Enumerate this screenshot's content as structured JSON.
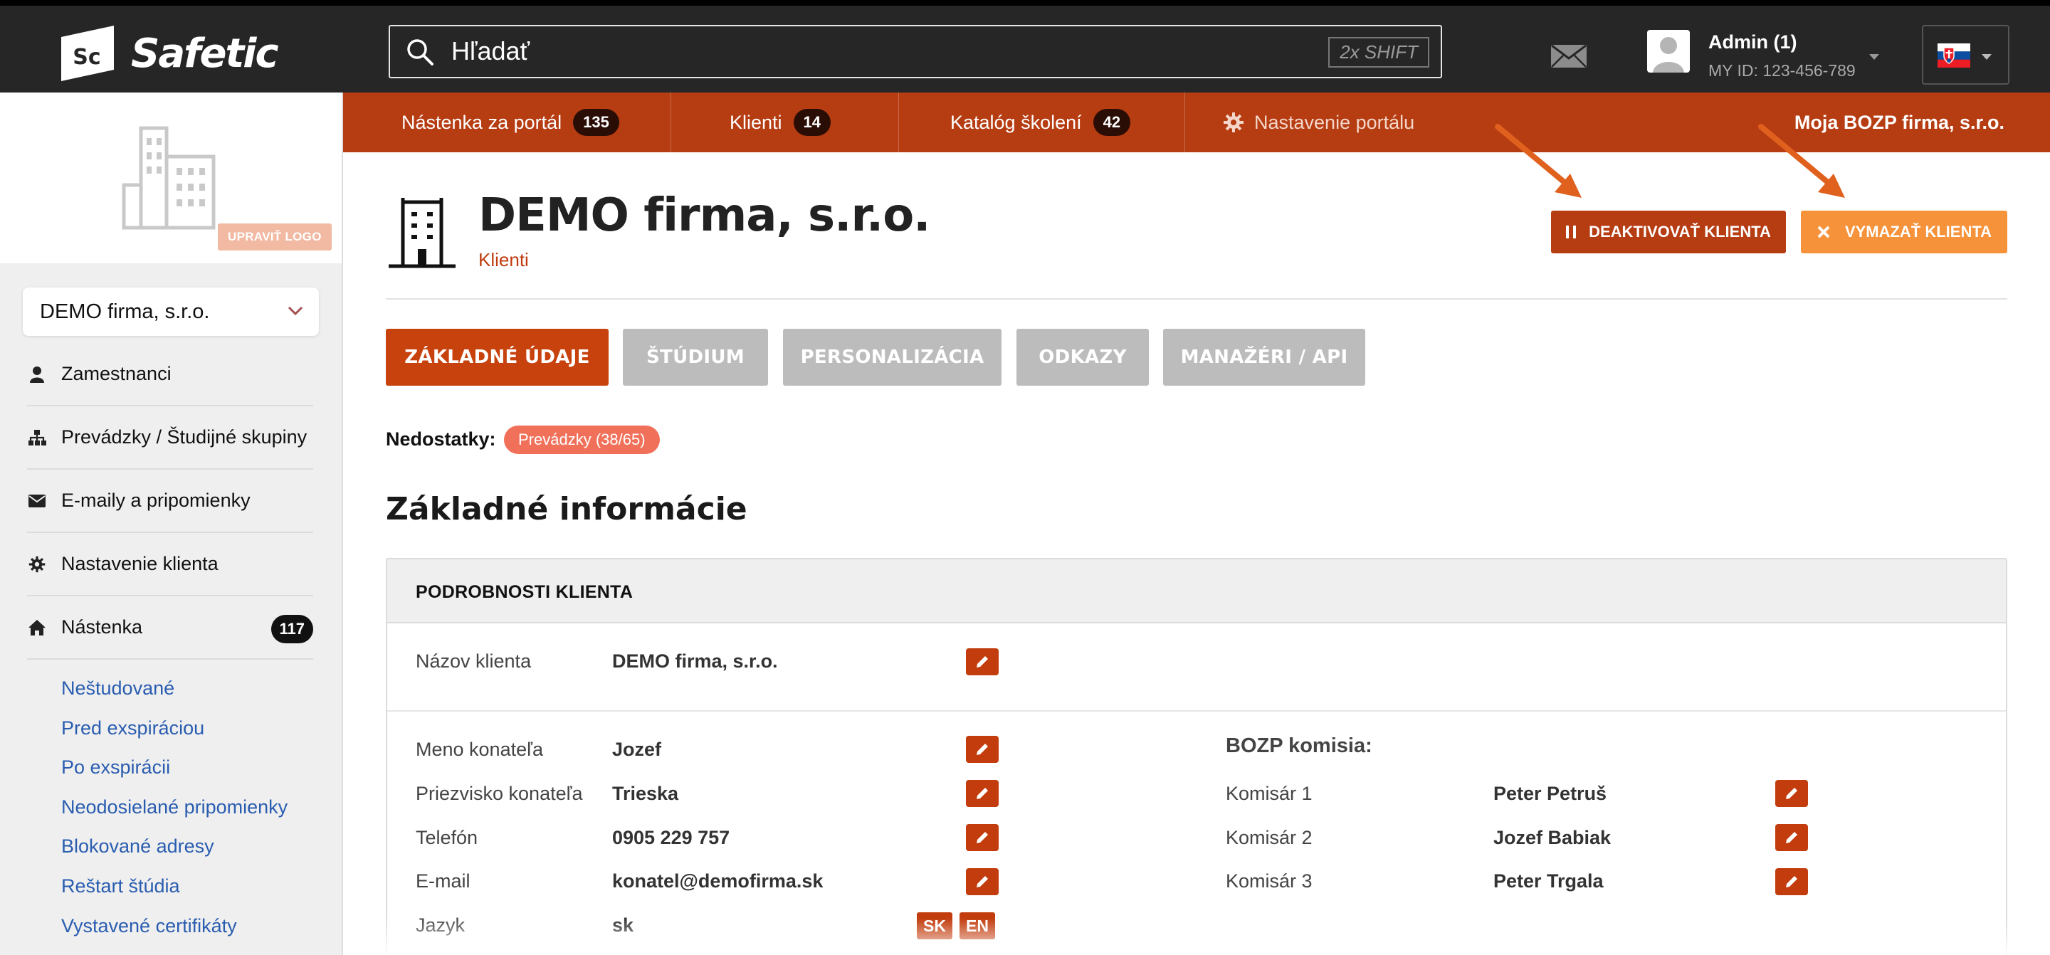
{
  "app": {
    "name": "Safetic",
    "logo_mark": "Sc"
  },
  "search": {
    "placeholder": "Hľadať",
    "shortcut_hint": "2x SHIFT"
  },
  "user": {
    "name": "Admin (1)",
    "id_label": "MY ID: 123-456-789"
  },
  "language_flag": "slovak-flag-icon",
  "nav": {
    "items": [
      {
        "label": "Nástenka za portál",
        "count": "135"
      },
      {
        "label": "Klienti",
        "count": "14"
      },
      {
        "label": "Katalóg školení",
        "count": "42"
      },
      {
        "label": "Nastavenie portálu"
      }
    ],
    "company": "Moja BOZP firma, s.r.o."
  },
  "sidebar": {
    "edit_logo": "UPRAVIŤ LOGO",
    "client_selected": "DEMO firma, s.r.o.",
    "items": [
      {
        "label": "Zamestnanci",
        "icon": "person-icon"
      },
      {
        "label": "Prevádzky / Študijné skupiny",
        "icon": "org-chart-icon"
      },
      {
        "label": "E-maily a pripomienky",
        "icon": "envelope-icon"
      },
      {
        "label": "Nastavenie klienta",
        "icon": "gear-icon"
      },
      {
        "label": "Nástenka",
        "icon": "home-icon",
        "count": "117"
      }
    ],
    "sub_links": [
      "Neštudované",
      "Pred exspiráciou",
      "Po exspirácii",
      "Neodosielané pripomienky",
      "Blokované adresy",
      "Reštart štúdia",
      "Vystavené certifikáty"
    ]
  },
  "page": {
    "title": "DEMO firma, s.r.o.",
    "breadcrumb": "Klienti",
    "deactivate_label": "DEAKTIVOVAŤ KLIENTA",
    "delete_label": "VYMAZAŤ KLIENTA"
  },
  "tabs": [
    {
      "label": "ZÁKLADNÉ ÚDAJE",
      "active": true
    },
    {
      "label": "ŠTÚDIUM",
      "active": false
    },
    {
      "label": "PERSONALIZÁCIA",
      "active": false
    },
    {
      "label": "ODKAZY",
      "active": false
    },
    {
      "label": "MANAŽÉRI / API",
      "active": false
    }
  ],
  "issues": {
    "label": "Nedostatky:",
    "pill": "Prevádzky (38/65)"
  },
  "section_title": "Základné informácie",
  "details": {
    "header": "PODROBNOSTI KLIENTA",
    "client_name_label": "Názov klienta",
    "client_name_value": "DEMO firma, s.r.o.",
    "fields": [
      {
        "label": "Meno konateľa",
        "value": "Jozef"
      },
      {
        "label": "Priezvisko konateľa",
        "value": "Trieska"
      },
      {
        "label": "Telefón",
        "value": "0905 229 757"
      },
      {
        "label": "E-mail",
        "value": "konatel@demofirma.sk"
      },
      {
        "label": "Jazyk",
        "value": "sk"
      }
    ],
    "languages": [
      "SK",
      "EN"
    ],
    "committee": {
      "title": "BOZP komisia:",
      "members": [
        {
          "label": "Komisár 1",
          "value": "Peter Petruš"
        },
        {
          "label": "Komisár 2",
          "value": "Jozef Babiak"
        },
        {
          "label": "Komisár 3",
          "value": "Peter Trgala"
        }
      ]
    }
  },
  "colors": {
    "topbar": "#262626",
    "brand": "#b63c12",
    "accent_orange": "#f5923a",
    "pill": "#f1705a",
    "link": "#2a5db0"
  }
}
